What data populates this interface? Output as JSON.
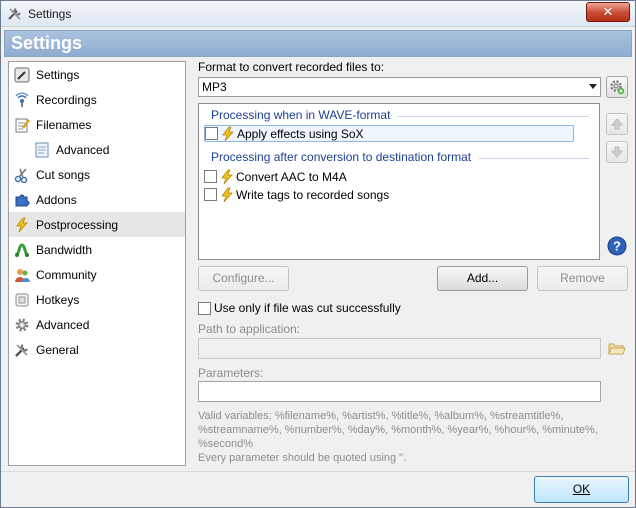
{
  "window": {
    "title": "Settings",
    "close_glyph": "✕"
  },
  "header": {
    "title": "Settings"
  },
  "sidebar": {
    "items": [
      {
        "label": "Settings",
        "icon": "settings-icon"
      },
      {
        "label": "Recordings",
        "icon": "recordings-icon"
      },
      {
        "label": "Filenames",
        "icon": "filenames-icon"
      },
      {
        "label": "Advanced",
        "icon": "advanced-file-icon",
        "sub": true
      },
      {
        "label": "Cut songs",
        "icon": "scissors-icon"
      },
      {
        "label": "Addons",
        "icon": "puzzle-icon"
      },
      {
        "label": "Postprocessing",
        "icon": "lightning-icon",
        "active": true
      },
      {
        "label": "Bandwidth",
        "icon": "bandwidth-icon"
      },
      {
        "label": "Community",
        "icon": "community-icon"
      },
      {
        "label": "Hotkeys",
        "icon": "hotkeys-icon"
      },
      {
        "label": "Advanced",
        "icon": "gear-icon"
      },
      {
        "label": "General",
        "icon": "tools-icon"
      }
    ]
  },
  "main": {
    "format_label": "Format to convert recorded files to:",
    "format_value": "MP3",
    "group1_title": "Processing when in WAVE-format",
    "group1_items": [
      {
        "label": "Apply effects using SoX",
        "selected": true
      }
    ],
    "group2_title": "Processing after conversion to destination format",
    "group2_items": [
      {
        "label": "Convert AAC to M4A"
      },
      {
        "label": "Write tags to recorded songs"
      }
    ],
    "configure_label": "Configure...",
    "add_label": "Add...",
    "remove_label": "Remove",
    "only_if_cut_label": "Use only if file was cut successfully",
    "path_label": "Path to application:",
    "path_value": "",
    "params_label": "Parameters:",
    "params_value": "",
    "hint_text": "Valid variables: %filename%, %artist%, %title%, %album%, %streamtitle%, %streamname%, %number%, %day%, %month%, %year%, %hour%, %minute%, %second%",
    "hint_text2": "Every parameter should be quoted using \"."
  },
  "footer": {
    "ok_label": "OK"
  },
  "colors": {
    "accent": "#8fadd0",
    "group_heading": "#1e3f8f"
  }
}
